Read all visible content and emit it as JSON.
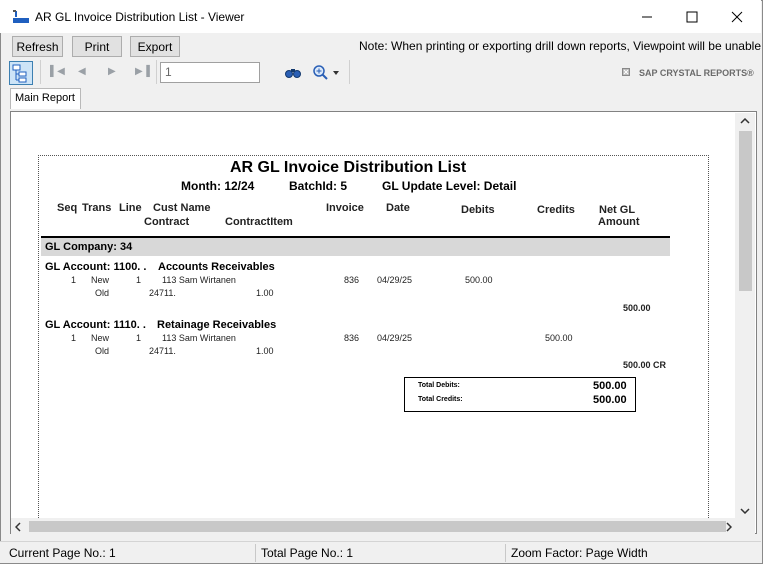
{
  "window": {
    "title": "AR GL Invoice Distribution List - Viewer"
  },
  "toolbar": {
    "refresh_label": "Refresh",
    "print_label": "Print",
    "export_label": "Export",
    "note": "Note: When printing or exporting drill down reports, Viewpoint will be unable to set or s",
    "page_value": "1",
    "brand": "SAP CRYSTAL REPORTS®"
  },
  "tabs": [
    {
      "label": "Main Report"
    }
  ],
  "report": {
    "title": "AR GL Invoice Distribution List",
    "month": "Month: 12/24",
    "batch": "BatchId: 5",
    "gl_level": "GL Update Level: Detail",
    "columns": {
      "seq": "Seq",
      "trans": "Trans",
      "line": "Line",
      "cust_name": "Cust Name",
      "contract": "Contract",
      "contract_item": "ContractItem",
      "invoice": "Invoice",
      "date": "Date",
      "debits": "Debits",
      "credits": "Credits",
      "net_gl": "Net GL",
      "amount": "Amount"
    },
    "gl_company": "GL Company:  34",
    "accounts": [
      {
        "header": "GL Account:  1100.  .",
        "name": "Accounts Receivables",
        "seq": "1",
        "trans": "New",
        "line": "1",
        "cust": "113  Sam Wirtanen",
        "trans2": "Old",
        "contract": "24711.",
        "contract_item": "1.00",
        "invoice": "836",
        "date": "04/29/25",
        "debit": "500.00",
        "credit": "",
        "subtotal": "500.00"
      },
      {
        "header": "GL Account:  1110.  .",
        "name": "Retainage Receivables",
        "seq": "1",
        "trans": "New",
        "line": "1",
        "cust": "113  Sam Wirtanen",
        "trans2": "Old",
        "contract": "24711.",
        "contract_item": "1.00",
        "invoice": "836",
        "date": "04/29/25",
        "debit": "",
        "credit": "500.00",
        "subtotal": "500.00  CR"
      }
    ],
    "totals": {
      "debits_label": "Total Debits:",
      "debits_value": "500.00",
      "credits_label": "Total Credits:",
      "credits_value": "500.00"
    }
  },
  "status": {
    "current_page": "Current Page No.: 1",
    "total_page": "Total Page No.: 1",
    "zoom": "Zoom Factor: Page Width"
  }
}
